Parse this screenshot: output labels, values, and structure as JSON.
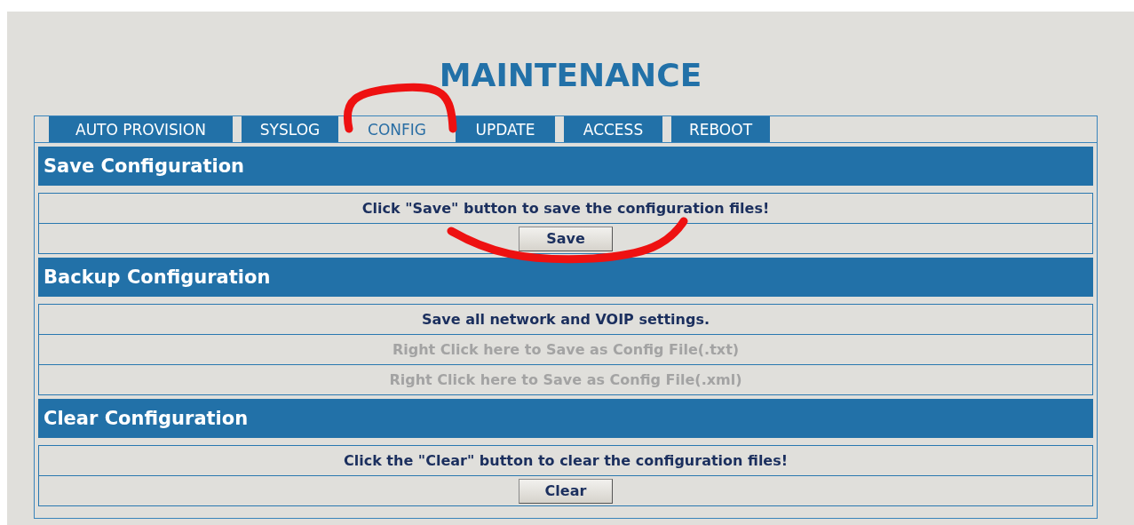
{
  "title": "MAINTENANCE",
  "tabs": [
    {
      "label": "AUTO PROVISION",
      "selected": false
    },
    {
      "label": "SYSLOG",
      "selected": false
    },
    {
      "label": "CONFIG",
      "selected": true
    },
    {
      "label": "UPDATE",
      "selected": false
    },
    {
      "label": "ACCESS",
      "selected": false
    },
    {
      "label": "REBOOT",
      "selected": false
    }
  ],
  "sections": [
    {
      "title": "Save Configuration",
      "rows": [
        {
          "kind": "text",
          "text": "Click \"Save\" button to save the configuration files!"
        },
        {
          "kind": "button",
          "text": "Save"
        }
      ]
    },
    {
      "title": "Backup Configuration",
      "rows": [
        {
          "kind": "text",
          "text": "Save all network and VOIP settings."
        },
        {
          "kind": "link",
          "text": "Right Click here to Save as Config File(.txt)"
        },
        {
          "kind": "link",
          "text": "Right Click here to Save as Config File(.xml)"
        }
      ]
    },
    {
      "title": "Clear Configuration",
      "rows": [
        {
          "kind": "text",
          "text": "Click the \"Clear\" button to clear the configuration files!"
        },
        {
          "kind": "button",
          "text": "Clear"
        }
      ]
    }
  ]
}
